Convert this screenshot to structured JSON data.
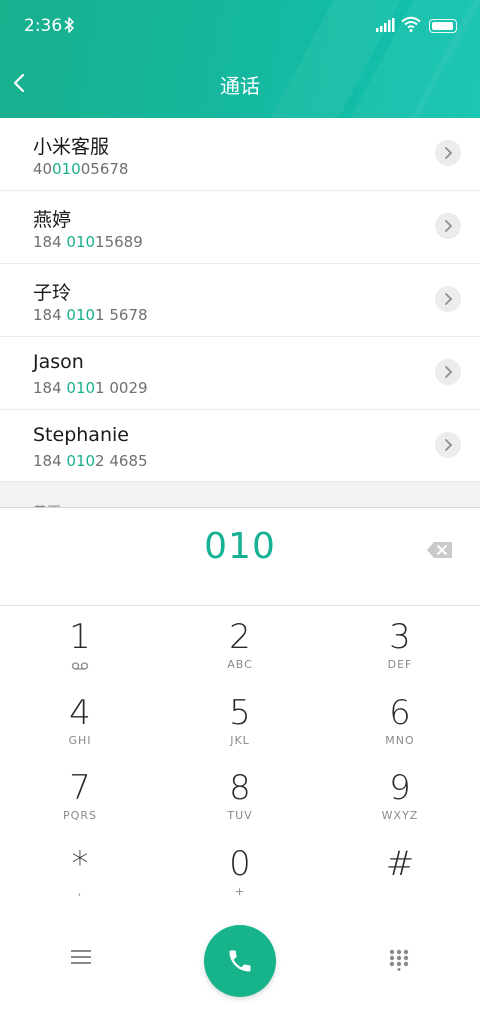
{
  "status": {
    "time": "2:36"
  },
  "header": {
    "title": "通话"
  },
  "contacts": [
    {
      "name": "小米客服",
      "pre": "40",
      "hl": "010",
      "post": "05678"
    },
    {
      "name": "燕婷",
      "pre": "184 ",
      "hl": "010",
      "post": "15689"
    },
    {
      "name": "子玲",
      "pre": "184 ",
      "hl": "010",
      "post": "1 5678"
    },
    {
      "name": "Jason",
      "pre": "184 ",
      "hl": "010",
      "post": "1 0029"
    },
    {
      "name": "Stephanie",
      "pre": "184 ",
      "hl": "010",
      "post": "2 4685"
    }
  ],
  "more_section": {
    "label": "黄页"
  },
  "dialer": {
    "input": "010",
    "keys": [
      {
        "num": "1",
        "letters": ""
      },
      {
        "num": "2",
        "letters": "ABC"
      },
      {
        "num": "3",
        "letters": "DEF"
      },
      {
        "num": "4",
        "letters": "GHI"
      },
      {
        "num": "5",
        "letters": "JKL"
      },
      {
        "num": "6",
        "letters": "MNO"
      },
      {
        "num": "7",
        "letters": "PQRS"
      },
      {
        "num": "8",
        "letters": "TUV"
      },
      {
        "num": "9",
        "letters": "WXYZ"
      },
      {
        "num": "*",
        "letters": ","
      },
      {
        "num": "0",
        "letters": "+"
      },
      {
        "num": "#",
        "letters": ""
      }
    ]
  },
  "colors": {
    "accent": "#18b08d",
    "header_start": "#19b08e",
    "header_end": "#10c3b0"
  },
  "icons": [
    "bluetooth-icon",
    "signal-icon",
    "wifi-icon",
    "battery-icon",
    "back-icon",
    "chevron-right-icon",
    "backspace-icon",
    "voicemail-icon",
    "menu-icon",
    "phone-icon",
    "dialpad-icon"
  ]
}
